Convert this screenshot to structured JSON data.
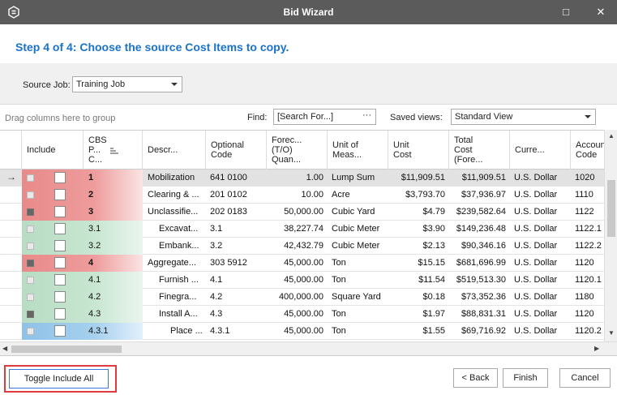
{
  "window": {
    "title": "Bid Wizard",
    "minimize": "□",
    "close": "✕"
  },
  "step": {
    "title": "Step 4 of 4: Choose the source Cost Items to copy."
  },
  "source": {
    "label": "Source Job:",
    "value": "Training Job"
  },
  "toolbar": {
    "group_hint": "Drag columns here to group",
    "find_label": "Find:",
    "find_placeholder": "[Search For...]",
    "find_button": "···",
    "saved_views_label": "Saved views:",
    "saved_views_value": "Standard View"
  },
  "grid": {
    "columns": [
      "Include",
      "CBS\nP...\nC...",
      "Descr...",
      "Optional\nCode",
      "Forec...\n(T/O)\nQuan...",
      "Unit of\nMeas...",
      "Unit\nCost",
      "Total\nCost\n(Fore...",
      "Curre...",
      "Account\nCode"
    ],
    "rows": [
      {
        "indicator": "→",
        "state": "plus",
        "color": "red",
        "cbs": "1",
        "bold": true,
        "desc": "Mobilization",
        "code": "641 0100",
        "qty": "1.00",
        "uom": "Lump Sum",
        "unit_cost": "$11,909.51",
        "total": "$11,909.51",
        "currency": "U.S. Dollar",
        "account": "1020"
      },
      {
        "indicator": "",
        "state": "plus",
        "color": "red",
        "cbs": "2",
        "bold": true,
        "desc": "Clearing & ...",
        "code": "201 0102",
        "qty": "10.00",
        "uom": "Acre",
        "unit_cost": "$3,793.70",
        "total": "$37,936.97",
        "currency": "U.S. Dollar",
        "account": "1110"
      },
      {
        "indicator": "",
        "state": "minus",
        "color": "red",
        "cbs": "3",
        "bold": true,
        "desc": "Unclassifie...",
        "code": "202 0183",
        "qty": "50,000.00",
        "uom": "Cubic Yard",
        "unit_cost": "$4.79",
        "total": "$239,582.64",
        "currency": "U.S. Dollar",
        "account": "1122"
      },
      {
        "indicator": "",
        "state": "plus",
        "color": "green",
        "cbs": "3.1",
        "bold": false,
        "desc": "Excavat...",
        "code": "3.1",
        "qty": "38,227.74",
        "uom": "Cubic Meter",
        "unit_cost": "$3.90",
        "total": "$149,236.48",
        "currency": "U.S. Dollar",
        "account": "1122.1"
      },
      {
        "indicator": "",
        "state": "plus",
        "color": "green",
        "cbs": "3.2",
        "bold": false,
        "desc": "Embank...",
        "code": "3.2",
        "qty": "42,432.79",
        "uom": "Cubic Meter",
        "unit_cost": "$2.13",
        "total": "$90,346.16",
        "currency": "U.S. Dollar",
        "account": "1122.2"
      },
      {
        "indicator": "",
        "state": "minus",
        "color": "red",
        "cbs": "4",
        "bold": true,
        "desc": "Aggregate...",
        "code": "303 5912",
        "qty": "45,000.00",
        "uom": "Ton",
        "unit_cost": "$15.15",
        "total": "$681,696.99",
        "currency": "U.S. Dollar",
        "account": "1120"
      },
      {
        "indicator": "",
        "state": "plus",
        "color": "green",
        "cbs": "4.1",
        "bold": false,
        "desc": "Furnish ...",
        "code": "4.1",
        "qty": "45,000.00",
        "uom": "Ton",
        "unit_cost": "$11.54",
        "total": "$519,513.30",
        "currency": "U.S. Dollar",
        "account": "1120.1"
      },
      {
        "indicator": "",
        "state": "plus",
        "color": "green",
        "cbs": "4.2",
        "bold": false,
        "desc": "Finegra...",
        "code": "4.2",
        "qty": "400,000.00",
        "uom": "Square Yard",
        "unit_cost": "$0.18",
        "total": "$73,352.36",
        "currency": "U.S. Dollar",
        "account": "1180"
      },
      {
        "indicator": "",
        "state": "minus",
        "color": "green",
        "cbs": "4.3",
        "bold": false,
        "desc": "Install A...",
        "code": "4.3",
        "qty": "45,000.00",
        "uom": "Ton",
        "unit_cost": "$1.97",
        "total": "$88,831.31",
        "currency": "U.S. Dollar",
        "account": "1120"
      },
      {
        "indicator": "",
        "state": "plus",
        "color": "blue",
        "cbs": "4.3.1",
        "bold": false,
        "desc": "Place ...",
        "code": "4.3.1",
        "qty": "45,000.00",
        "uom": "Ton",
        "unit_cost": "$1.55",
        "total": "$69,716.92",
        "currency": "U.S. Dollar",
        "account": "1120.2"
      }
    ]
  },
  "footer": {
    "toggle_label": "Toggle Include All",
    "back_label": "< Back",
    "finish_label": "Finish",
    "cancel_label": "Cancel"
  },
  "colors": {
    "accent": "#1a73c9",
    "titlebar": "#5b5b5b",
    "highlight": "#e0393e"
  }
}
